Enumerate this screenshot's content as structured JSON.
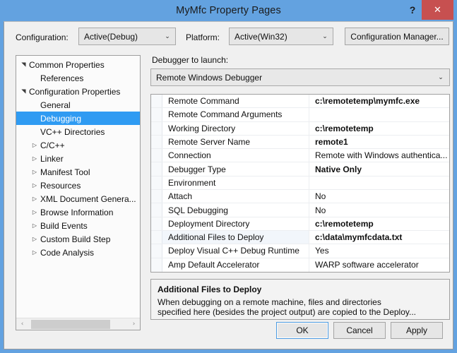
{
  "window": {
    "title": "MyMfc Property Pages",
    "help_glyph": "?",
    "close_glyph": "✕",
    "frame_color": "#63a2e0",
    "close_color": "#c75050"
  },
  "toolbar": {
    "configuration_label": "Configuration:",
    "configuration_value": "Active(Debug)",
    "platform_label": "Platform:",
    "platform_value": "Active(Win32)",
    "configuration_manager_label": "Configuration Manager...",
    "chevron": "⌄"
  },
  "tree": {
    "items": [
      {
        "label": "Common Properties",
        "depth": 0,
        "state": "expanded",
        "selected": false
      },
      {
        "label": "References",
        "depth": 1,
        "state": "leaf",
        "selected": false
      },
      {
        "label": "Configuration Properties",
        "depth": 0,
        "state": "expanded",
        "selected": false
      },
      {
        "label": "General",
        "depth": 1,
        "state": "leaf",
        "selected": false
      },
      {
        "label": "Debugging",
        "depth": 1,
        "state": "leaf",
        "selected": true
      },
      {
        "label": "VC++ Directories",
        "depth": 1,
        "state": "leaf",
        "selected": false
      },
      {
        "label": "C/C++",
        "depth": 1,
        "state": "collapsed",
        "selected": false
      },
      {
        "label": "Linker",
        "depth": 1,
        "state": "collapsed",
        "selected": false
      },
      {
        "label": "Manifest Tool",
        "depth": 1,
        "state": "collapsed",
        "selected": false
      },
      {
        "label": "Resources",
        "depth": 1,
        "state": "collapsed",
        "selected": false
      },
      {
        "label": "XML Document Genera...",
        "depth": 1,
        "state": "collapsed",
        "selected": false
      },
      {
        "label": "Browse Information",
        "depth": 1,
        "state": "collapsed",
        "selected": false
      },
      {
        "label": "Build Events",
        "depth": 1,
        "state": "collapsed",
        "selected": false
      },
      {
        "label": "Custom Build Step",
        "depth": 1,
        "state": "collapsed",
        "selected": false
      },
      {
        "label": "Code Analysis",
        "depth": 1,
        "state": "collapsed",
        "selected": false
      }
    ],
    "glyph_expanded": "◢",
    "glyph_collapsed": "▷",
    "scroll_left_arrow": "‹",
    "scroll_right_arrow": "›",
    "selection_color": "#2f9bf2"
  },
  "main": {
    "debugger_launch_label": "Debugger to launch:",
    "debugger_launch_value": "Remote Windows Debugger",
    "chevron": "⌄",
    "properties": [
      {
        "name": "Remote Command",
        "value": "c:\\remotetemp\\mymfc.exe",
        "bold": true,
        "selected": false
      },
      {
        "name": "Remote Command Arguments",
        "value": "",
        "bold": false,
        "selected": false
      },
      {
        "name": "Working Directory",
        "value": "c:\\remotetemp",
        "bold": true,
        "selected": false
      },
      {
        "name": "Remote Server Name",
        "value": "remote1",
        "bold": true,
        "selected": false
      },
      {
        "name": "Connection",
        "value": "Remote with Windows authentica...",
        "bold": false,
        "selected": false
      },
      {
        "name": "Debugger Type",
        "value": "Native Only",
        "bold": true,
        "selected": false
      },
      {
        "name": "Environment",
        "value": "",
        "bold": false,
        "selected": false
      },
      {
        "name": "Attach",
        "value": "No",
        "bold": false,
        "selected": false
      },
      {
        "name": "SQL Debugging",
        "value": "No",
        "bold": false,
        "selected": false
      },
      {
        "name": "Deployment Directory",
        "value": "c:\\remotetemp",
        "bold": true,
        "selected": false
      },
      {
        "name": "Additional Files to Deploy",
        "value": "c:\\data\\mymfcdata.txt",
        "bold": true,
        "selected": true
      },
      {
        "name": "Deploy Visual C++ Debug Runtime",
        "value": "Yes",
        "bold": false,
        "selected": false
      },
      {
        "name": "Amp Default Accelerator",
        "value": "WARP software accelerator",
        "bold": false,
        "selected": false
      }
    ],
    "description": {
      "title": "Additional Files to Deploy",
      "text": "When debugging on a remote machine, files and directories\nspecified here (besides the project output) are copied to the Deploy..."
    }
  },
  "footer": {
    "ok_label": "OK",
    "cancel_label": "Cancel",
    "apply_label": "Apply"
  }
}
